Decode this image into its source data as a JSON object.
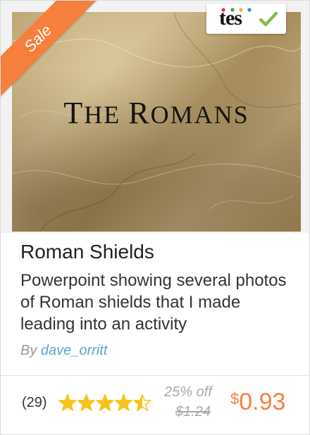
{
  "thumbnail": {
    "title_first": "T",
    "title_rest": "he ",
    "title_first2": "R",
    "title_rest2": "omans"
  },
  "badge": {
    "sale_label": "Sale",
    "logo_text": "tes",
    "logo_dot_colors": [
      "#e4257b",
      "#2ba84a",
      "#f7b21b",
      "#1b9ad6"
    ],
    "check_icon": "check-icon",
    "check_color": "#7cc142"
  },
  "resource": {
    "title": "Roman Shields",
    "description": "Powerpoint showing several photos of Roman shields that I made leading into an activity",
    "by_label": "By",
    "author": "dave_orritt"
  },
  "rating": {
    "count_text": "(29)",
    "stars": 4.5,
    "max_stars": 5,
    "star_color": "#f7c21b"
  },
  "pricing": {
    "discount": "25% off",
    "original_price": "$1.24",
    "currency": "$",
    "price": "0.93",
    "accent_color": "#f5803e"
  }
}
